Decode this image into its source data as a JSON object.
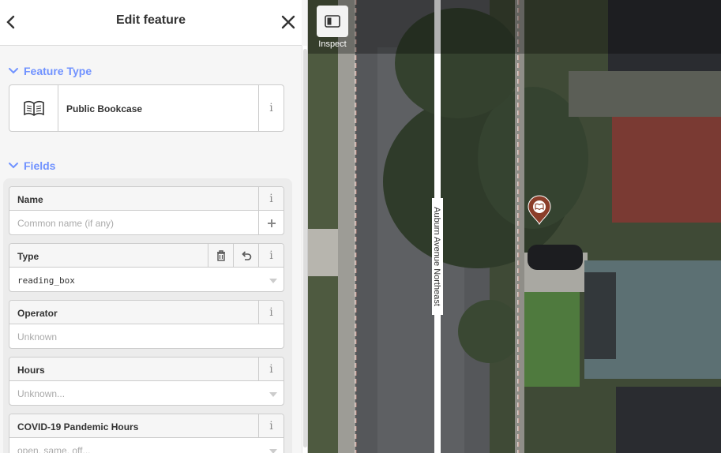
{
  "header": {
    "title": "Edit feature",
    "back_icon": "chevron-left-icon",
    "close_icon": "close-icon"
  },
  "feature_type": {
    "section_label": "Feature Type",
    "preset_name": "Public Bookcase",
    "preset_icon": "book-icon",
    "info_label": "i"
  },
  "fields": {
    "section_label": "Fields",
    "items": [
      {
        "label": "Name",
        "placeholder": "Common name (if any)"
      },
      {
        "label": "Type",
        "value": "reading_box"
      },
      {
        "label": "Operator",
        "placeholder": "Unknown"
      },
      {
        "label": "Hours",
        "placeholder": "Unknown..."
      },
      {
        "label": "COVID-19 Pandemic Hours",
        "placeholder": "open, same, off..."
      }
    ]
  },
  "map": {
    "inspect_label": "Inspect",
    "street_name": "Auburn Avenue Northeast",
    "marker_color": "#8b3e2a",
    "accent_color": "#7092ff"
  }
}
